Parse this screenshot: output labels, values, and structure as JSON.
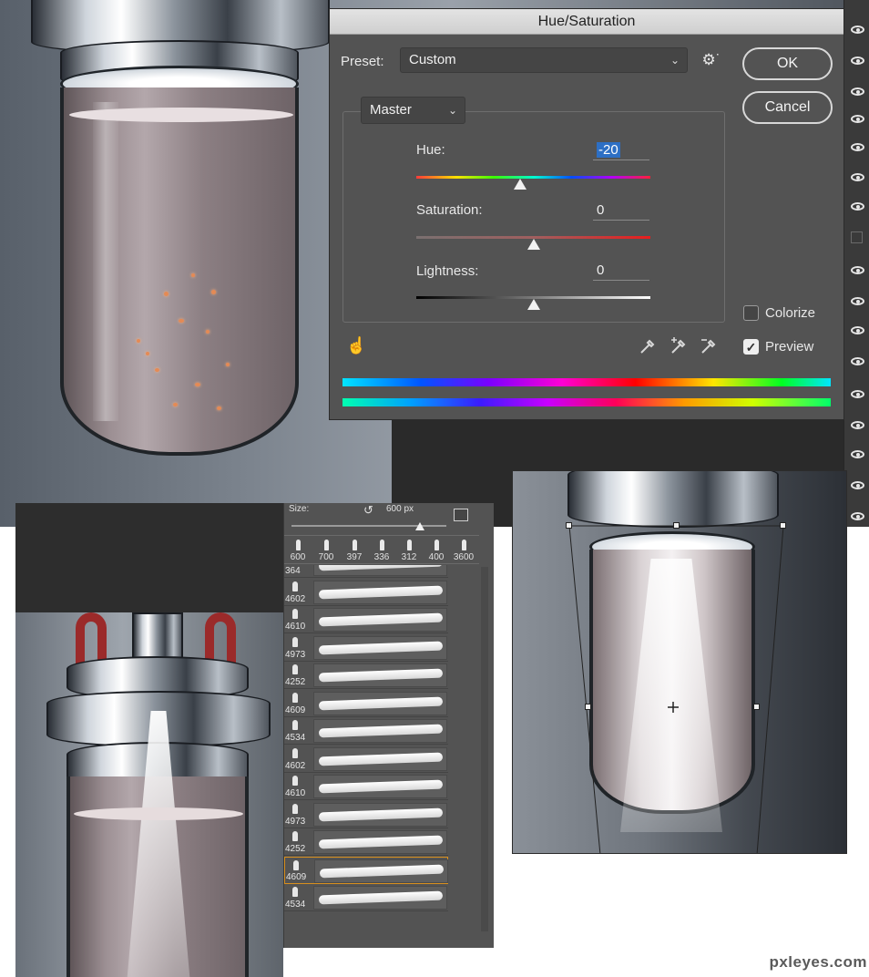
{
  "dialog": {
    "title": "Hue/Saturation",
    "preset_label": "Preset:",
    "preset_value": "Custom",
    "ok_label": "OK",
    "cancel_label": "Cancel",
    "channel_value": "Master",
    "hue_label": "Hue:",
    "hue_value": "-20",
    "hue_level": -20,
    "saturation_label": "Saturation:",
    "saturation_value": "0",
    "saturation_level": 0,
    "lightness_label": "Lightness:",
    "lightness_value": "0",
    "lightness_level": 0,
    "colorize_label": "Colorize",
    "colorize_checked": false,
    "preview_label": "Preview",
    "preview_checked": true
  },
  "brush_panel": {
    "size_label": "Size:",
    "size_value": "600 px",
    "recent_sizes": [
      "600",
      "700",
      "397",
      "336",
      "312",
      "400",
      "3600"
    ],
    "brushes": [
      "364",
      "4602",
      "4610",
      "4973",
      "4252",
      "4609",
      "4534",
      "4602",
      "4610",
      "4973",
      "4252",
      "4609",
      "4534"
    ],
    "selected_brush_index": 11
  },
  "layers": {
    "visibility_icons": [
      "eye-icon",
      "eye-icon",
      "eye-icon",
      "eye-icon",
      "eye-icon",
      "eye-icon",
      "eye-icon",
      "eye-icon",
      "empty-box",
      "eye-icon",
      "eye-icon",
      "eye-icon",
      "eye-icon",
      "eye-icon",
      "eye-icon",
      "eye-icon",
      "eye-icon",
      "eye-icon"
    ]
  },
  "watermark": "pxleyes.com",
  "colors": {
    "dialog_bg": "#535353",
    "highlight": "#2d6fc4",
    "selected_brush_border": "#d88f1e"
  }
}
